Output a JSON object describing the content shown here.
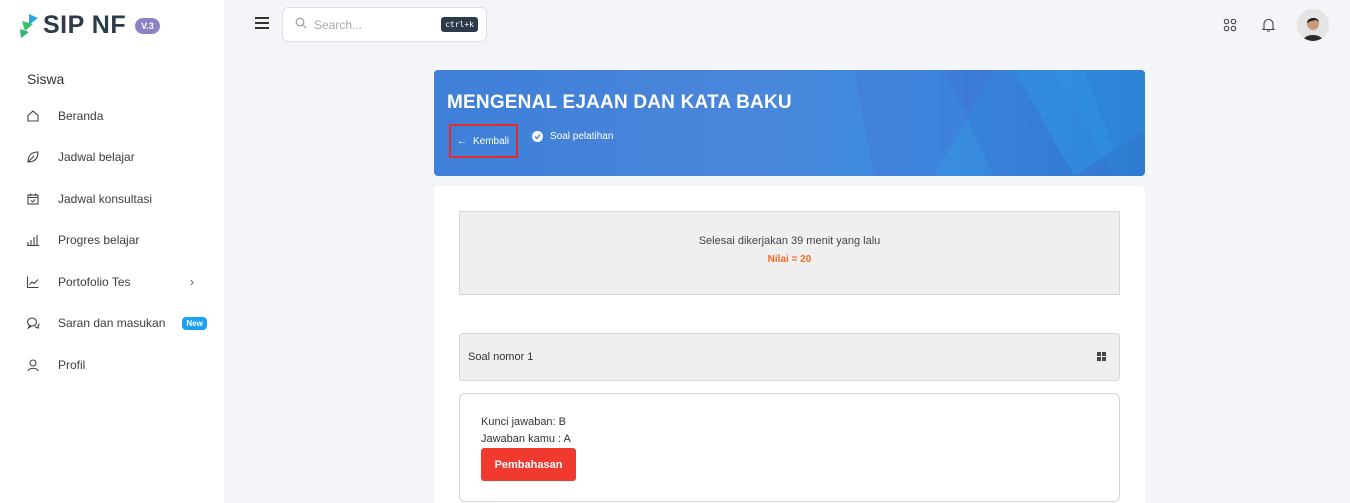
{
  "app": {
    "name": "SIP NF",
    "version": "V.3"
  },
  "sidebar": {
    "section": "Siswa",
    "items": [
      {
        "label": "Beranda",
        "icon": "home-icon"
      },
      {
        "label": "Jadwal belajar",
        "icon": "leaf-icon"
      },
      {
        "label": "Jadwal konsultasi",
        "icon": "calendar-check-icon"
      },
      {
        "label": "Progres belajar",
        "icon": "bar-chart-icon"
      },
      {
        "label": "Portofolio Tes",
        "icon": "line-chart-icon",
        "chevron": "›"
      },
      {
        "label": "Saran dan masukan",
        "icon": "chat-icon",
        "badge": "New"
      },
      {
        "label": "Profil",
        "icon": "user-icon"
      }
    ]
  },
  "topbar": {
    "search_placeholder": "Search...",
    "search_shortcut": "ctrl+k",
    "icons": [
      "apps-icon",
      "bell-icon",
      "avatar"
    ]
  },
  "banner": {
    "title": "MENGENAL EJAAN DAN KATA BAKU",
    "back_label": "Kembali",
    "practice_label": "Soal pelatihan"
  },
  "result": {
    "status": "Selesai dikerjakan 39 menit yang lalu",
    "score": "Nilai = 20"
  },
  "question": {
    "header": "Soal nomor 1",
    "answer_key": "Kunci jawaban: B",
    "your_answer": "Jawaban kamu : A",
    "discussion_label": "Pembahasan"
  },
  "colors": {
    "accent_blue": "#3f7fd8",
    "score_orange": "#f06a23",
    "danger_red": "#f13a2f",
    "badge_purple": "#8b83c6",
    "badge_new": "#1da1f2"
  }
}
